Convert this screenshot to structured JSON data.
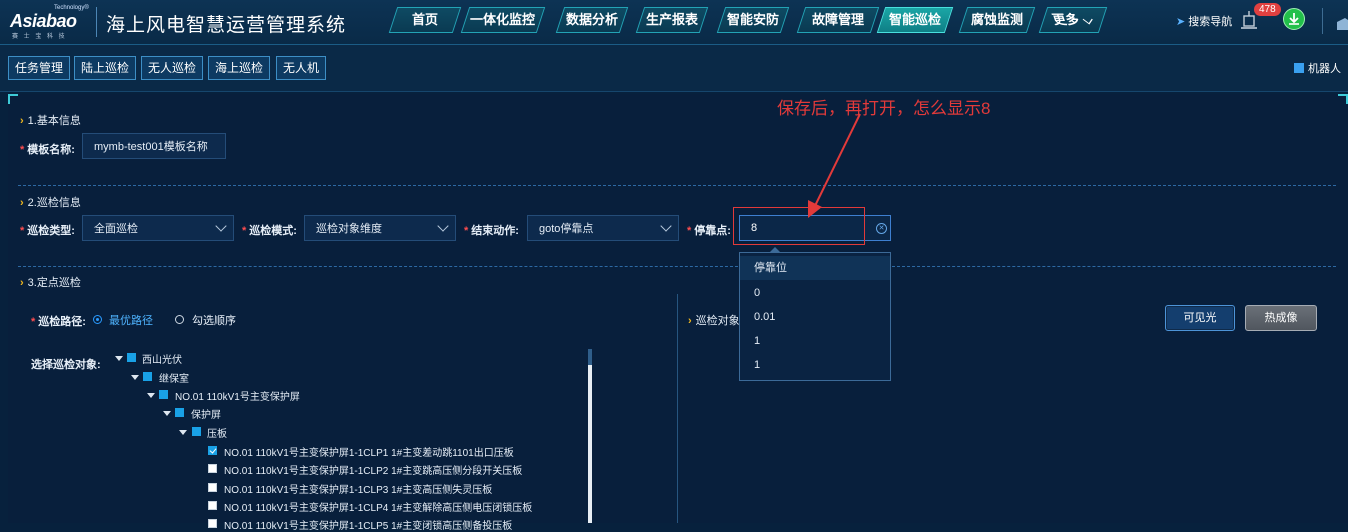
{
  "header": {
    "logo_text": "Asiabao",
    "logo_tech": "Technology®",
    "logo_sub": "赛 士 宝 科 技",
    "system_title": "海上风电智慧运营管理系统",
    "nav": [
      "首页",
      "一体化监控",
      "数据分析",
      "生产报表",
      "智能安防",
      "故障管理",
      "智能巡检",
      "腐蚀监测",
      "更多"
    ],
    "active_nav": "智能巡检",
    "search_nav": "搜索导航",
    "notification_count": "478"
  },
  "subnav": {
    "buttons": [
      "任务管理",
      "陆上巡检",
      "无人巡检",
      "海上巡检",
      "无人机"
    ],
    "robot_label": "机器人"
  },
  "annotation": "保存后，再打开，怎么显示8",
  "section1": {
    "title": "1.基本信息",
    "template_name_label": "模板名称:",
    "template_name_value": "mymb-test001模板名称"
  },
  "section2": {
    "title": "2.巡检信息",
    "type_label": "巡检类型:",
    "type_value": "全面巡检",
    "mode_label": "巡检模式:",
    "mode_value": "巡检对象维度",
    "end_action_label": "结束动作:",
    "end_action_value": "goto停靠点",
    "stop_label": "停靠点:",
    "stop_value": "8",
    "dropdown_options": [
      "停靠位",
      "0",
      "0.01",
      "1",
      "1"
    ]
  },
  "section3": {
    "title": "3.定点巡检",
    "route_label": "巡检路径:",
    "route_options": [
      "最优路径",
      "勾选顺序"
    ],
    "route_selected": "最优路径",
    "select_label": "选择巡检对象:",
    "right_title": "巡检对象",
    "btn_visible": "可见光",
    "btn_thermal": "热成像",
    "tree": [
      "西山光伏",
      "继保室",
      "NO.01 110kV1号主变保护屏",
      "保护屏",
      "压板",
      "NO.01 110kV1号主变保护屏1-1CLP1 1#主变差动跳1101出口压板",
      "NO.01 110kV1号主变保护屏1-1CLP2 1#主变跳高压侧分段开关压板",
      "NO.01 110kV1号主变保护屏1-1CLP3 1#主变高压侧失灵压板",
      "NO.01 110kV1号主变保护屏1-1CLP4 1#主变解除高压侧电压闭锁压板",
      "NO.01 110kV1号主变保护屏1-1CLP5 1#主变闭锁高压侧备投压板"
    ]
  }
}
